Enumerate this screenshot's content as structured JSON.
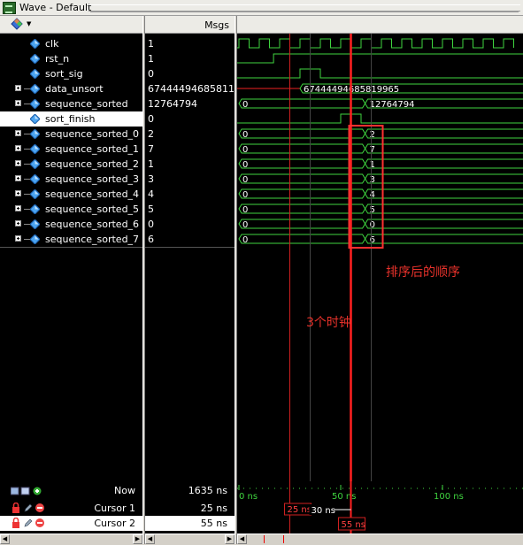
{
  "window": {
    "title": "Wave - Default"
  },
  "header": {
    "msgs_label": "Msgs"
  },
  "signals": [
    {
      "name": "clk",
      "value": "1",
      "expandable": false
    },
    {
      "name": "rst_n",
      "value": "1",
      "expandable": false
    },
    {
      "name": "sort_sig",
      "value": "0",
      "expandable": false
    },
    {
      "name": "data_unsort",
      "value": "67444494685811...",
      "expandable": true
    },
    {
      "name": "sequence_sorted",
      "value": "12764794",
      "expandable": true
    },
    {
      "name": "sort_finish",
      "value": "0",
      "expandable": false,
      "selected": true
    },
    {
      "name": "sequence_sorted_0",
      "value": "2",
      "expandable": true
    },
    {
      "name": "sequence_sorted_1",
      "value": "7",
      "expandable": true
    },
    {
      "name": "sequence_sorted_2",
      "value": "1",
      "expandable": true
    },
    {
      "name": "sequence_sorted_3",
      "value": "3",
      "expandable": true
    },
    {
      "name": "sequence_sorted_4",
      "value": "4",
      "expandable": true
    },
    {
      "name": "sequence_sorted_5",
      "value": "5",
      "expandable": true
    },
    {
      "name": "sequence_sorted_6",
      "value": "0",
      "expandable": true
    },
    {
      "name": "sequence_sorted_7",
      "value": "6",
      "expandable": true
    }
  ],
  "wave_labels": {
    "data_unsort_new": "67444494685819965",
    "sequence_sorted_old": "0",
    "sequence_sorted_new": "12764794",
    "bus_old": "0",
    "bus_new": [
      "2",
      "7",
      "1",
      "3",
      "4",
      "5",
      "0",
      "6"
    ]
  },
  "timeline": {
    "ticks": [
      "0 ns",
      "50 ns",
      "100 ns"
    ],
    "cursor1_label": "25 ns",
    "cursor2_label": "55 ns",
    "delta_label": "30 ns"
  },
  "status": {
    "now_label": "Now",
    "now_value": "1635 ns",
    "cursors": [
      {
        "label": "Cursor 1",
        "value": "25 ns",
        "selected": false
      },
      {
        "label": "Cursor 2",
        "value": "55 ns",
        "selected": true
      }
    ]
  },
  "annotations": {
    "sorted_order": "排序后的顺序",
    "three_clocks": "3个时钟"
  },
  "colors": {
    "wave_green": "#3fd53f",
    "cursor_red": "#ff2020",
    "annotation_red": "#e8322b"
  }
}
